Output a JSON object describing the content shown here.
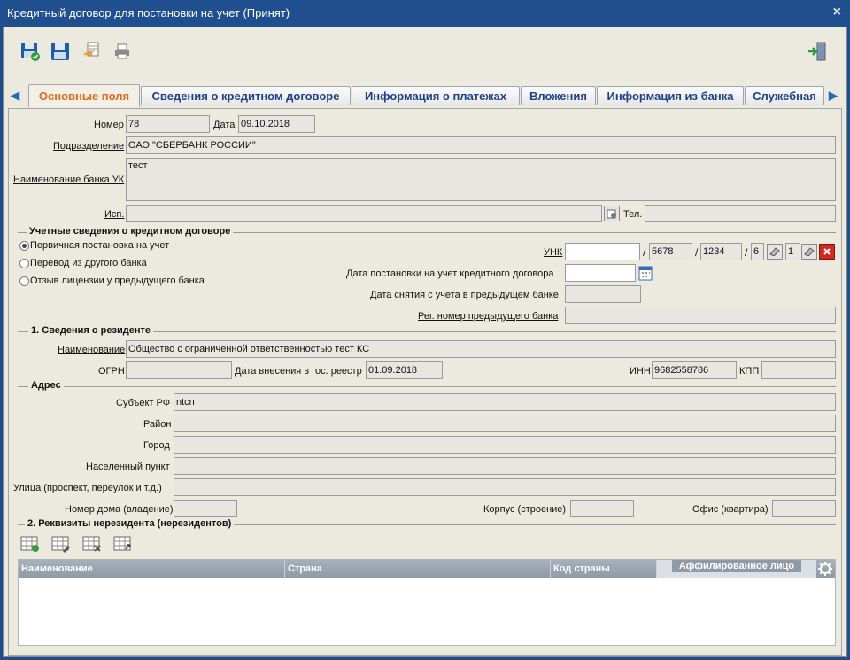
{
  "window": {
    "title": "Кредитный договор для постановки на учет (Принят)",
    "close": "×"
  },
  "toolbar": {
    "icons": [
      "save-ok-icon",
      "save-icon",
      "export-icon",
      "print-icon",
      "exit-icon"
    ]
  },
  "tabs": [
    {
      "label": "Основные поля",
      "active": true
    },
    {
      "label": "Сведения о кредитном договоре"
    },
    {
      "label": "Информация о платежах"
    },
    {
      "label": "Вложения"
    },
    {
      "label": "Информация из банка"
    },
    {
      "label": "Служебная"
    }
  ],
  "general": {
    "number_label": "Номер",
    "number": "78",
    "date_label": "Дата",
    "date": "09.10.2018",
    "division_label": "Подразделение",
    "division": "ОАО \"СБЕРБАНК РОССИИ\"",
    "bank_name_label": "Наименование банка УК",
    "bank_name": "тест",
    "executor_label": "Исп.",
    "executor": "",
    "phone_label": "Тел.",
    "phone": ""
  },
  "accounting": {
    "title": "Учетные сведения о кредитном договоре",
    "options": [
      {
        "label": "Первичная постановка на учет",
        "selected": true
      },
      {
        "label": "Перевод из другого банка",
        "selected": false
      },
      {
        "label": "Отзыв лицензии у предыдущего банка",
        "selected": false
      }
    ],
    "unk_label": "УНК",
    "unk_1": "",
    "unk_2": "5678",
    "unk_3": "1234",
    "unk_4": "6",
    "unk_5": "1",
    "slash": "/",
    "reg_date_label": "Дата постановки на учет кредитного договора",
    "reg_date": "",
    "dereg_date_label": "Дата снятия с учета в предыдущем банке",
    "dereg_date": "",
    "prev_bank_reg_label": "Рег. номер предыдущего банка",
    "prev_bank_reg": ""
  },
  "resident": {
    "title": "1. Сведения о резиденте",
    "name_label": "Наименование",
    "name": "Общество с ограниченной ответственностью тест КС",
    "ogrn_label": "ОГРН",
    "ogrn": "",
    "reg_date_label": "Дата внесения в гос. реестр",
    "reg_date": "01.09.2018",
    "inn_label": "ИНН",
    "inn": "9682558786",
    "kpp_label": "КПП",
    "kpp": ""
  },
  "address": {
    "title": "Адрес",
    "subject_label": "Субъект РФ",
    "subject": "ntcn",
    "district_label": "Район",
    "district": "",
    "city_label": "Город",
    "city": "",
    "settlement_label": "Населенный пункт",
    "settlement": "",
    "street_label": "Улица (проспект, переулок и т.д.)",
    "street": "",
    "house_label": "Номер дома (владение)",
    "house": "",
    "building_label": "Корпус (строение)",
    "building": "",
    "office_label": "Офис (квартира)",
    "office": ""
  },
  "nonresident": {
    "title": "2. Реквизиты нерезидента (нерезидентов)",
    "columns": [
      "Наименование",
      "Страна",
      "Код страны",
      "Аффилированное лицо"
    ]
  },
  "colors": {
    "accent_tab": "#e06a17",
    "tab_text": "#1c3f8a",
    "titlebar": "#1f4f8f",
    "panel": "#ece9df"
  }
}
